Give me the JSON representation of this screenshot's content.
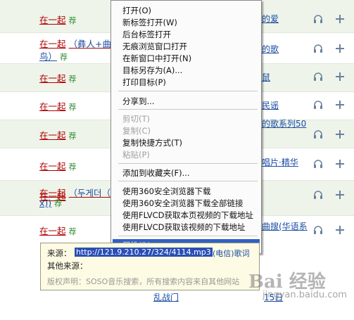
{
  "rows": [
    {
      "song": "在一起",
      "rec": "荐",
      "right": "的爱"
    },
    {
      "song": "在一起",
      "extra": "（彝人+曲",
      "cont": "鸟）",
      "rec": "荐",
      "right": "的歌"
    },
    {
      "song": "在一起",
      "rec": "荐",
      "right": "鼠"
    },
    {
      "song": "在一起",
      "rec": "荐",
      "right": "民谣"
    },
    {
      "song": "在一起",
      "rec": "荐",
      "right": "的歌系列50"
    },
    {
      "song": "在一起",
      "rec": "荐",
      "right": "唱片·精华"
    },
    {
      "song": "在一起",
      "rec": "荐",
      "right": ""
    },
    {
      "song": "在一起",
      "extra": "（두게더（",
      "cont": "x))",
      "rec": "荐",
      "right": ""
    },
    {
      "song": "在一起",
      "rec": "荐",
      "right": "曲搜(华语系"
    }
  ],
  "menu": {
    "items": [
      {
        "label": "打开(O)",
        "disabled": false
      },
      {
        "label": "新标签打开(W)",
        "disabled": false
      },
      {
        "label": "后台标签打开",
        "disabled": false
      },
      {
        "label": "无痕浏览窗口打开",
        "disabled": false
      },
      {
        "label": "在新窗口中打开(N)",
        "disabled": false
      },
      {
        "label": "目标另存为(A)...",
        "disabled": false
      },
      {
        "label": "打印目标(P)",
        "disabled": false
      },
      {
        "label": "分享到...",
        "disabled": false
      },
      {
        "label": "剪切(T)",
        "disabled": true
      },
      {
        "label": "复制(C)",
        "disabled": true
      },
      {
        "label": "复制快捷方式(T)",
        "disabled": false
      },
      {
        "label": "粘贴(P)",
        "disabled": true
      },
      {
        "label": "添加到收藏夹(F)...",
        "disabled": false
      },
      {
        "label": "使用360安全浏览器下载",
        "disabled": false
      },
      {
        "label": "使用360安全浏览器下载全部链接",
        "disabled": false
      },
      {
        "label": "使用FLVCD获取本页视频的下载地址",
        "disabled": false
      },
      {
        "label": "使用FLVCD获取该视频的下载地址",
        "disabled": false
      },
      {
        "label": "属性(R)",
        "disabled": false,
        "selected": true
      }
    ]
  },
  "tooltip": {
    "source_label": "来源：",
    "url": "http://121.9.210.27/324/4114.mp3",
    "url_suffix": "(电信)歌词",
    "other_label": "其他来源：",
    "copyright": "版权声明：SOSO音乐搜索，所有搜索内容来自其他网站"
  },
  "bottom": {
    "left_link": "乱战门",
    "right_link": "15日"
  },
  "watermark": {
    "text": "Bai  经验",
    "sub": "jingyan.baidu.com"
  },
  "colors": {
    "row_alt": "#eef4ea",
    "song_red": "#b00000",
    "link_blue": "#1a4ca3",
    "menu_highlight": "#3161c3",
    "rec_green": "#2f8a2f"
  }
}
